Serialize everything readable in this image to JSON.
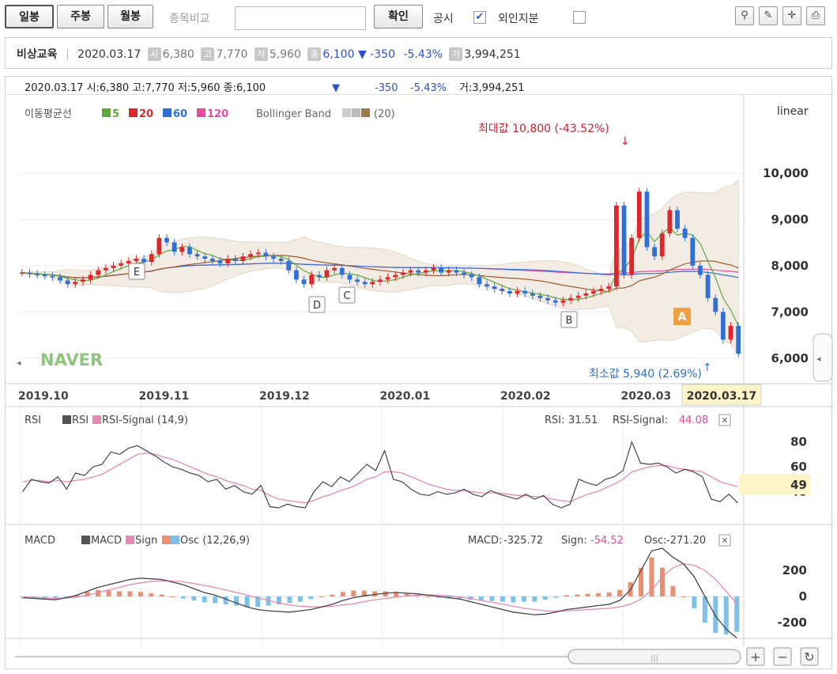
{
  "toolbar": {
    "tabs": [
      "일봉",
      "주봉",
      "월봉"
    ],
    "compare_label": "종목비교",
    "confirm": "확인",
    "disclosure": "공시",
    "disclosure_checked": true,
    "foreign": "외인지분",
    "foreign_checked": false,
    "icons": [
      "pin-icon",
      "pencil-icon",
      "crosshair-icon",
      "print-icon"
    ]
  },
  "info": {
    "name": "비상교육",
    "date": "2020.03.17",
    "open_tag": "시",
    "open": "6,380",
    "high_tag": "고",
    "high": "7,770",
    "low_tag": "저",
    "low": "5,960",
    "close_tag": "종",
    "close": "6,100",
    "change": "-350",
    "change_pct": "-5.43%",
    "vol_tag": "거",
    "volume": "3,994,251"
  },
  "chart_header": {
    "text": "2020.03.17 시:6,380 고:7,770 저:5,960 종:6,100",
    "change": "-350",
    "pct": "-5.43%",
    "vol": "거:3,994,251"
  },
  "legend": {
    "ma_label": "이동평균선",
    "ma": [
      {
        "name": "5",
        "color": "#5aaa3c"
      },
      {
        "name": "20",
        "color": "#e0252c"
      },
      {
        "name": "60",
        "color": "#2f6fd6"
      },
      {
        "name": "120",
        "color": "#e94aa0"
      }
    ],
    "bb_label": "Bollinger Band",
    "bb_param": "(20)",
    "scale": "linear"
  },
  "annotations": {
    "max": "최대값 10,800 (-43.52%)",
    "min": "최소값 5,940 (2.69%)",
    "watermark": "NAVER",
    "current_date": "2020.03.17",
    "markers": [
      "E",
      "D",
      "C",
      "B",
      "A"
    ]
  },
  "rsi_panel": {
    "title": "RSI",
    "legend": "RSI",
    "legend2": "RSI-Signal (14,9)",
    "rsi_label": "RSI:",
    "rsi_value": "31.51",
    "sig_label": "RSI-Signal:",
    "sig_value": "44.08",
    "current": "49"
  },
  "macd_panel": {
    "title": "MACD",
    "legend": "MACD",
    "legend2": "Sign",
    "legend3": "Osc (12,26,9)",
    "macd_label": "MACD:",
    "macd_value": "-325.72",
    "sign_label": "Sign:",
    "sign_value": "-54.52",
    "osc_label": "Osc:",
    "osc_value": "-271.20"
  },
  "colors": {
    "up": "#e0252c",
    "down": "#2f6fd6",
    "bb_fill": "#f3ece4",
    "bb_line": "#a07a44"
  },
  "chart_data": {
    "type": "candlestick",
    "x_ticks": [
      "2019.10",
      "2019.11",
      "2019.12",
      "2020.01",
      "2020.02",
      "2020.03"
    ],
    "price_ticks": [
      6000,
      7000,
      8000,
      9000,
      10000
    ],
    "price_range": [
      5500,
      11400
    ],
    "max_price": 10800,
    "min_price": 5940,
    "close_series": [
      7850,
      7820,
      7800,
      7780,
      7750,
      7680,
      7600,
      7650,
      7700,
      7800,
      7900,
      7950,
      8000,
      8050,
      8100,
      8150,
      8080,
      8250,
      8600,
      8500,
      8300,
      8400,
      8250,
      8200,
      8150,
      8100,
      8050,
      8150,
      8100,
      8200,
      8250,
      8280,
      8200,
      8150,
      8100,
      7900,
      7700,
      7600,
      7800,
      7750,
      7900,
      7950,
      7800,
      7700,
      7650,
      7600,
      7650,
      7700,
      7750,
      7800,
      7850,
      7900,
      7850,
      7900,
      7950,
      7850,
      7900,
      7850,
      7800,
      7750,
      7600,
      7550,
      7500,
      7450,
      7400,
      7450,
      7400,
      7350,
      7300,
      7250,
      7200,
      7250,
      7300,
      7350,
      7400,
      7450,
      7500,
      7550,
      9300,
      7800,
      8600,
      9600,
      8400,
      8200,
      8700,
      9200,
      8800,
      8600,
      8000,
      7800,
      7300,
      7000,
      6400,
      6700,
      6100
    ],
    "rsi_ticks": [
      40,
      60,
      80
    ],
    "rsi_series": [
      40,
      50,
      48,
      47,
      52,
      42,
      55,
      53,
      60,
      62,
      72,
      70,
      75,
      77,
      73,
      69,
      64,
      60,
      58,
      55,
      53,
      48,
      50,
      42,
      45,
      40,
      38,
      45,
      28,
      27,
      30,
      28,
      27,
      40,
      48,
      44,
      52,
      48,
      55,
      62,
      57,
      73,
      50,
      48,
      42,
      38,
      37,
      40,
      38,
      39,
      42,
      38,
      36,
      41,
      38,
      36,
      34,
      38,
      34,
      37,
      30,
      27,
      30,
      50,
      47,
      45,
      50,
      52,
      57,
      80,
      63,
      62,
      63,
      60,
      55,
      58,
      56,
      52,
      34,
      32,
      38,
      31
    ],
    "rsi_signal": [
      48,
      49,
      49,
      48,
      49,
      48,
      49,
      50,
      52,
      54,
      58,
      62,
      66,
      70,
      71,
      70,
      68,
      66,
      63,
      60,
      57,
      54,
      52,
      49,
      47,
      45,
      42,
      41,
      37,
      34,
      33,
      32,
      31,
      33,
      36,
      38,
      41,
      43,
      46,
      50,
      52,
      56,
      56,
      55,
      52,
      49,
      46,
      44,
      42,
      41,
      41,
      40,
      39,
      39,
      39,
      38,
      37,
      37,
      36,
      36,
      34,
      33,
      32,
      35,
      38,
      40,
      43,
      46,
      50,
      56,
      58,
      60,
      61,
      61,
      59,
      58,
      57,
      56,
      52,
      48,
      46,
      44
    ],
    "macd_ticks": [
      -200,
      0,
      200
    ],
    "macd_series": [
      -10,
      -15,
      -20,
      -25,
      -10,
      10,
      40,
      70,
      90,
      110,
      130,
      140,
      135,
      130,
      110,
      90,
      60,
      30,
      10,
      -20,
      -50,
      -80,
      -100,
      -110,
      -115,
      -120,
      -110,
      -100,
      -80,
      -60,
      -30,
      -10,
      5,
      15,
      25,
      30,
      25,
      20,
      10,
      0,
      -10,
      -20,
      -40,
      -60,
      -80,
      -100,
      -120,
      -130,
      -140,
      -135,
      -120,
      -100,
      -90,
      -80,
      -70,
      -60,
      -30,
      50,
      200,
      350,
      370,
      300,
      250,
      150,
      0,
      -150,
      -250,
      -320
    ],
    "macd_signal": [
      -5,
      -8,
      -12,
      -15,
      -12,
      -5,
      10,
      30,
      50,
      70,
      90,
      105,
      115,
      120,
      118,
      112,
      100,
      85,
      68,
      50,
      30,
      10,
      -10,
      -30,
      -50,
      -65,
      -75,
      -80,
      -80,
      -75,
      -65,
      -55,
      -40,
      -25,
      -15,
      -5,
      5,
      10,
      12,
      10,
      5,
      -5,
      -15,
      -30,
      -45,
      -60,
      -75,
      -90,
      -100,
      -110,
      -112,
      -110,
      -105,
      -100,
      -95,
      -90,
      -80,
      -60,
      -20,
      50,
      150,
      220,
      250,
      240,
      200,
      130,
      40,
      -55
    ],
    "osc_series": [
      -15,
      -12,
      -15,
      -14,
      -4,
      12,
      35,
      50,
      45,
      40,
      40,
      35,
      25,
      15,
      0,
      -15,
      -30,
      -45,
      -50,
      -60,
      -70,
      -80,
      -80,
      -70,
      -60,
      -50,
      -40,
      -20,
      0,
      15,
      35,
      45,
      45,
      40,
      40,
      35,
      20,
      10,
      0,
      -10,
      -15,
      -15,
      -25,
      -30,
      -35,
      -40,
      -45,
      -40,
      -40,
      -25,
      -10,
      10,
      15,
      20,
      25,
      30,
      50,
      110,
      220,
      300,
      220,
      80,
      0,
      -90,
      -200,
      -280,
      -290,
      -271
    ]
  }
}
